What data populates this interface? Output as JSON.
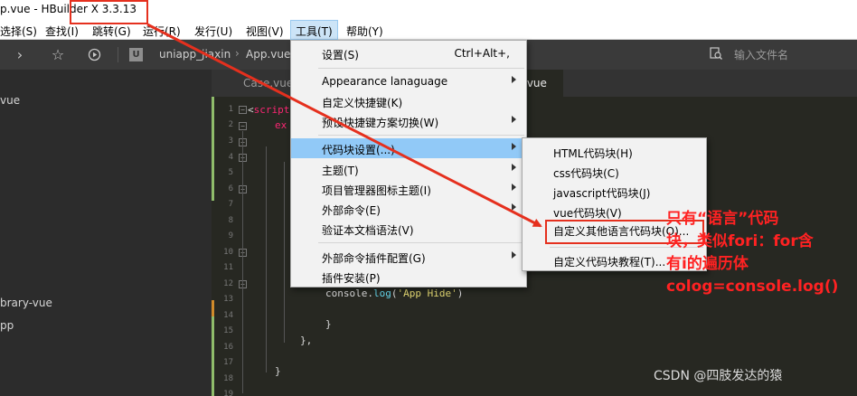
{
  "window": {
    "title": "p.vue - HBuilder X 3.3.13"
  },
  "menubar": [
    {
      "label": "选择(S)"
    },
    {
      "label": "查找(I)"
    },
    {
      "label": "跳转(G)"
    },
    {
      "label": "运行(R)"
    },
    {
      "label": "发行(U)"
    },
    {
      "label": "视图(V)"
    },
    {
      "label": "工具(T)",
      "active": true
    },
    {
      "label": "帮助(Y)"
    }
  ],
  "toolbar": {
    "breadcrumb": [
      "uniapp_jiaxin",
      "App.vue"
    ],
    "project_badge": "U",
    "file_search_placeholder": "输入文件名"
  },
  "sidebar": {
    "items": [
      "vue",
      "brary-vue",
      "pp"
    ]
  },
  "tabs": [
    {
      "label": "Case.vue",
      "active": false
    },
    {
      "label": ".vue",
      "active": true
    }
  ],
  "editor": {
    "line_numbers": [
      "1",
      "2",
      "3",
      "4",
      "5",
      "6",
      "7",
      "8",
      "9",
      "10",
      "11",
      "12",
      "13",
      "14",
      "15",
      "16",
      "17",
      "18",
      "19"
    ],
    "code_script": "script",
    "code_ex": "ex",
    "code_console": "console",
    "code_log": "log",
    "code_str": "'App Hide'",
    "code_brace1": "}",
    "code_brace2": "},",
    "code_brace3": "}"
  },
  "tools_menu": {
    "items": [
      {
        "label": "设置(S)",
        "shortcut": "Ctrl+Alt+,",
        "submenu": false
      },
      {
        "label": "Appearance lanaguage",
        "submenu": true
      },
      {
        "label": "自定义快捷键(K)",
        "submenu": false
      },
      {
        "label": "预设快捷键方案切换(W)",
        "submenu": true
      },
      {
        "label": "代码块设置(...)",
        "submenu": true,
        "highlighted": true
      },
      {
        "label": "主题(T)",
        "submenu": true
      },
      {
        "label": "项目管理器图标主题(I)",
        "submenu": true
      },
      {
        "label": "外部命令(E)",
        "submenu": true
      },
      {
        "label": "验证本文档语法(V)",
        "submenu": false
      },
      {
        "label": "外部命令插件配置(G)",
        "submenu": true
      },
      {
        "label": "插件安装(P)",
        "submenu": false
      }
    ]
  },
  "snippet_submenu": {
    "items": [
      {
        "label": "HTML代码块(H)"
      },
      {
        "label": "css代码块(C)"
      },
      {
        "label": "javascript代码块(J)"
      },
      {
        "label": "vue代码块(V)"
      },
      {
        "label": "自定义其他语言代码块(O)...",
        "boxed": true
      },
      {
        "label": "自定义代码块教程(T)..."
      }
    ]
  },
  "annotation": {
    "lines": [
      "只有“语言”代码",
      "块，类似fori：for含",
      "有i的遍历体",
      "colog=console.log()"
    ],
    "color": "#ff2222"
  },
  "watermark": "CSDN @四肢发达的猿",
  "colors": {
    "menu_highlight": "#91c9f7",
    "annotation_red": "#e5301e",
    "editor_bg": "#272822"
  }
}
